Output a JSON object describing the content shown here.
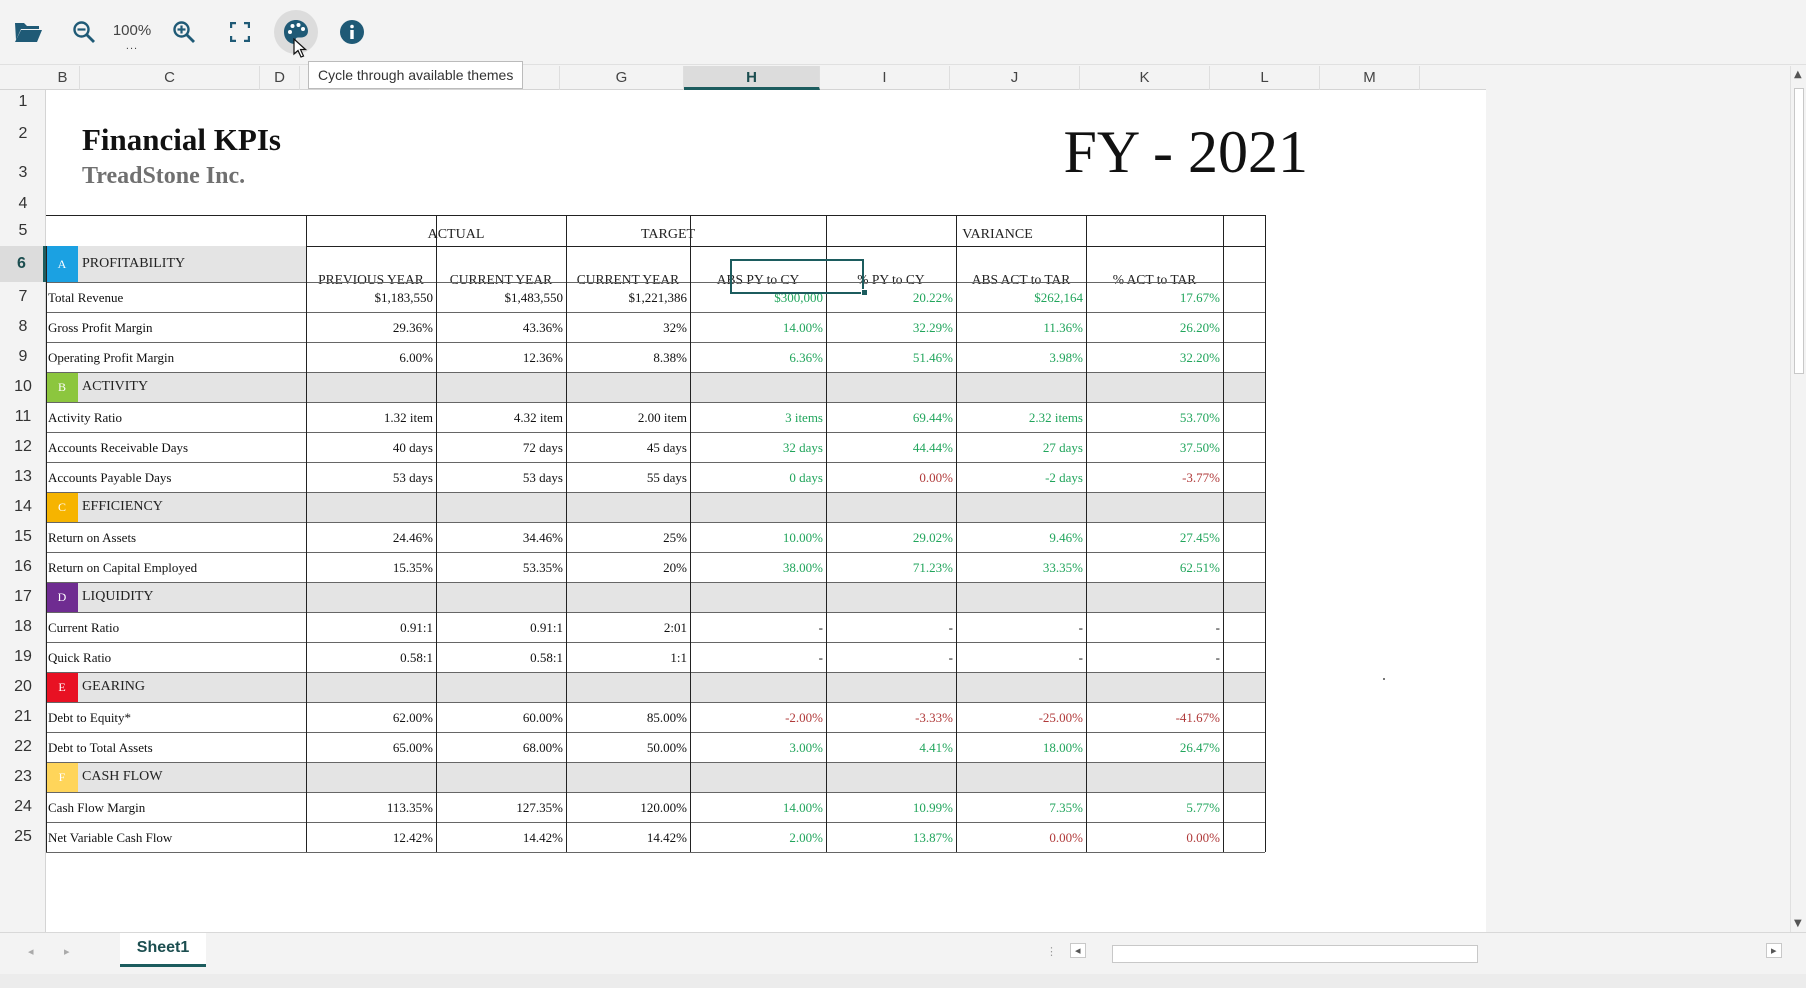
{
  "toolbar": {
    "zoom_level": "100%",
    "zoom_menu": "...",
    "tooltip": "Cycle through available themes",
    "icons": [
      "folder-open-icon",
      "zoom-out-icon",
      "zoom-in-icon",
      "fullscreen-icon",
      "palette-icon",
      "info-icon"
    ]
  },
  "columns": [
    "B",
    "C",
    "D",
    "E",
    "F",
    "G",
    "H",
    "I",
    "J",
    "K",
    "L",
    "M"
  ],
  "rows": [
    "1",
    "2",
    "3",
    "4",
    "5",
    "6",
    "7",
    "8",
    "9",
    "10",
    "11",
    "12",
    "13",
    "14",
    "15",
    "16",
    "17",
    "18",
    "19",
    "20",
    "21",
    "22",
    "23",
    "24",
    "25"
  ],
  "selected": {
    "column": "H",
    "row": "6"
  },
  "report": {
    "title": "Financial KPIs",
    "company": "TreadStone Inc.",
    "fiscal_year": "FY - 2021",
    "groups": {
      "actual": "ACTUAL",
      "target": "TARGET",
      "variance": "VARIANCE"
    },
    "column_headers": [
      "PREVIOUS YEAR",
      "CURRENT YEAR",
      "CURRENT YEAR",
      "ABS PY to CY",
      "% PY to CY",
      "ABS ACT to TAR",
      "%  ACT to TAR"
    ],
    "sections": [
      {
        "letter": "A",
        "name": "PROFITABILITY",
        "color": "#1ba1e2",
        "rows": [
          {
            "label": "Total Revenue",
            "values": [
              "$1,183,550",
              "$1,483,550",
              "$1,221,386",
              "$300,000",
              "20.22%",
              "$262,164",
              "17.67%"
            ],
            "tones": [
              "pos",
              "pos",
              "pos",
              "pos"
            ]
          },
          {
            "label": "Gross Profit Margin",
            "values": [
              "29.36%",
              "43.36%",
              "32%",
              "14.00%",
              "32.29%",
              "11.36%",
              "26.20%"
            ],
            "tones": [
              "pos",
              "pos",
              "pos",
              "pos"
            ]
          },
          {
            "label": "Operating Profit Margin",
            "values": [
              "6.00%",
              "12.36%",
              "8.38%",
              "6.36%",
              "51.46%",
              "3.98%",
              "32.20%"
            ],
            "tones": [
              "pos",
              "pos",
              "pos",
              "pos"
            ]
          }
        ]
      },
      {
        "letter": "B",
        "name": "ACTIVITY",
        "color": "#8cc63e",
        "rows": [
          {
            "label": "Activity Ratio",
            "values": [
              "1.32 item",
              "4.32 item",
              "2.00 item",
              "3 items",
              "69.44%",
              "2.32 items",
              "53.70%"
            ],
            "tones": [
              "pos",
              "pos",
              "pos",
              "pos"
            ]
          },
          {
            "label": "Accounts Receivable Days",
            "values": [
              "40 days",
              "72 days",
              "45 days",
              "32 days",
              "44.44%",
              "27 days",
              "37.50%"
            ],
            "tones": [
              "pos",
              "pos",
              "pos",
              "pos"
            ]
          },
          {
            "label": "Accounts Payable Days",
            "values": [
              "53 days",
              "53 days",
              "55 days",
              "0 days",
              "0.00%",
              "-2 days",
              "-3.77%"
            ],
            "tones": [
              "pos",
              "neg",
              "pos",
              "neg"
            ]
          }
        ]
      },
      {
        "letter": "C",
        "name": "EFFICIENCY",
        "color": "#f6b400",
        "rows": [
          {
            "label": "Return on Assets",
            "values": [
              "24.46%",
              "34.46%",
              "25%",
              "10.00%",
              "29.02%",
              "9.46%",
              "27.45%"
            ],
            "tones": [
              "pos",
              "pos",
              "pos",
              "pos"
            ]
          },
          {
            "label": "Return on Capital Employed",
            "values": [
              "15.35%",
              "53.35%",
              "20%",
              "38.00%",
              "71.23%",
              "33.35%",
              "62.51%"
            ],
            "tones": [
              "pos",
              "pos",
              "pos",
              "pos"
            ]
          }
        ]
      },
      {
        "letter": "D",
        "name": "LIQUIDITY",
        "color": "#6f2c91",
        "rows": [
          {
            "label": "Current Ratio",
            "values": [
              "0.91:1",
              "0.91:1",
              "2:01",
              "-",
              "-",
              "-",
              "-"
            ],
            "tones": [
              "plain",
              "plain",
              "plain",
              "plain"
            ]
          },
          {
            "label": "Quick Ratio",
            "values": [
              "0.58:1",
              "0.58:1",
              "1:1",
              "-",
              "-",
              "-",
              "-"
            ],
            "tones": [
              "plain",
              "plain",
              "plain",
              "plain"
            ]
          }
        ]
      },
      {
        "letter": "E",
        "name": "GEARING",
        "color": "#e81123",
        "rows": [
          {
            "label": "Debt to Equity*",
            "values": [
              "62.00%",
              "60.00%",
              "85.00%",
              "-2.00%",
              "-3.33%",
              "-25.00%",
              "-41.67%"
            ],
            "tones": [
              "neg",
              "neg",
              "neg",
              "neg"
            ]
          },
          {
            "label": "Debt to Total Assets",
            "values": [
              "65.00%",
              "68.00%",
              "50.00%",
              "3.00%",
              "4.41%",
              "18.00%",
              "26.47%"
            ],
            "tones": [
              "pos",
              "pos",
              "pos",
              "pos"
            ]
          }
        ]
      },
      {
        "letter": "F",
        "name": "CASH FLOW",
        "color": "#ffd55a",
        "rows": [
          {
            "label": "Cash Flow Margin",
            "values": [
              "113.35%",
              "127.35%",
              "120.00%",
              "14.00%",
              "10.99%",
              "7.35%",
              "5.77%"
            ],
            "tones": [
              "pos",
              "pos",
              "pos",
              "pos"
            ]
          },
          {
            "label": "Net Variable Cash Flow",
            "values": [
              "12.42%",
              "14.42%",
              "14.42%",
              "2.00%",
              "13.87%",
              "0.00%",
              "0.00%"
            ],
            "tones": [
              "pos",
              "pos",
              "neg",
              "neg"
            ]
          }
        ]
      }
    ]
  },
  "sheet_tab": "Sheet1"
}
